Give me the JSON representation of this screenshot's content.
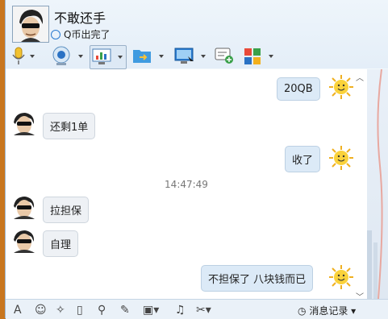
{
  "header": {
    "contact_name": "不敢还手",
    "status_text": "Q币出完了"
  },
  "toolbar": {
    "items": [
      "microphone-icon",
      "camera-icon",
      "screen-share-icon",
      "file-transfer-icon",
      "remote-desktop-icon",
      "add-message-icon",
      "apps-icon"
    ]
  },
  "chat": {
    "messages": [
      {
        "from": "me",
        "text": "20QB"
      },
      {
        "from": "them",
        "text": "还剩1单"
      },
      {
        "from": "me",
        "text": "收了"
      },
      {
        "from": "them",
        "text": "拉担保"
      },
      {
        "from": "them",
        "text": "自理"
      },
      {
        "from": "me",
        "text": "不担保了  八块钱而已"
      }
    ],
    "timestamp": "14:47:49"
  },
  "bottom": {
    "font_label": "A",
    "history_label": "消息记录"
  }
}
